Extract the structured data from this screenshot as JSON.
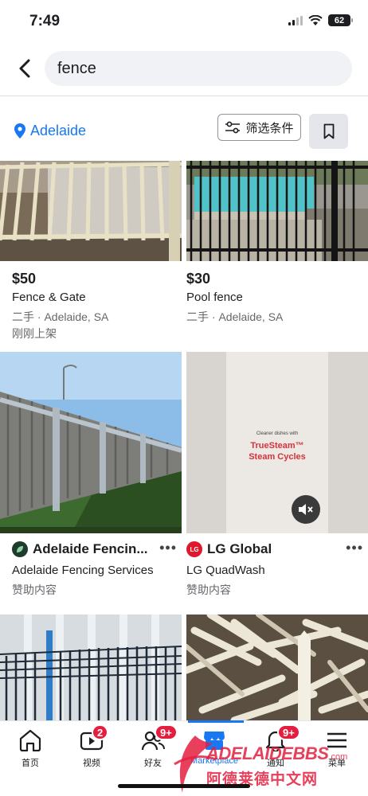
{
  "status": {
    "time": "7:49",
    "battery": "62"
  },
  "search": {
    "query": "fence"
  },
  "location": {
    "label": "Adelaide"
  },
  "filter": {
    "label": "筛选条件"
  },
  "listings": [
    {
      "price": "$50",
      "title": "Fence & Gate",
      "condition": "二手 · Adelaide, SA",
      "listed": "刚刚上架"
    },
    {
      "price": "$30",
      "title": "Pool fence",
      "condition": "二手 · Adelaide, SA"
    }
  ],
  "ads": [
    {
      "advertiser": "Adelaide Fencin...",
      "name": "Adelaide Fencing Services",
      "sponsored": "赞助内容",
      "logo_color": "#1f3b2c"
    },
    {
      "advertiser": "LG Global",
      "name": "LG QuadWash",
      "sponsored": "赞助内容",
      "logo_color": "#e0182d",
      "ad_text": {
        "small": "Cleaner dishes with",
        "headline1": "TrueSteam™",
        "headline2": "Steam Cycles"
      }
    }
  ],
  "tabs": [
    {
      "label": "首页",
      "icon": "home-icon"
    },
    {
      "label": "视频",
      "icon": "video-icon",
      "badge": "2"
    },
    {
      "label": "好友",
      "icon": "friends-icon",
      "badge": "9+"
    },
    {
      "label": "Marketplace",
      "icon": "marketplace-icon"
    },
    {
      "label": "通知",
      "icon": "bell-icon",
      "badge": "9+"
    },
    {
      "label": "菜单",
      "icon": "menu-icon"
    }
  ],
  "watermark": {
    "brand": "ADELAIDEBBS",
    "suffix": ".com",
    "chinese": "阿德莱德中文网"
  },
  "colors": {
    "accent": "#1877f2",
    "badge": "#e41e3f",
    "lg_red": "#e0182d"
  }
}
